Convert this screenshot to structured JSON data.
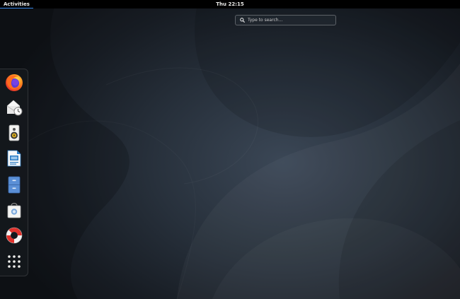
{
  "topbar": {
    "activities_label": "Activities",
    "clock": "Thu 22:15"
  },
  "search": {
    "placeholder": "Type to search…",
    "value": "",
    "icon": "search-icon"
  },
  "dash": {
    "items": [
      {
        "name": "firefox",
        "icon": "firefox-icon"
      },
      {
        "name": "evolution",
        "icon": "evolution-mail-icon"
      },
      {
        "name": "rhythmbox",
        "icon": "rhythmbox-speaker-icon"
      },
      {
        "name": "libreoffice-writer",
        "icon": "libreoffice-writer-icon"
      },
      {
        "name": "files",
        "icon": "files-cabinet-icon"
      },
      {
        "name": "software",
        "icon": "software-bag-icon"
      },
      {
        "name": "help",
        "icon": "help-lifebuoy-icon"
      },
      {
        "name": "show-applications",
        "icon": "app-grid-icon"
      }
    ]
  },
  "colors": {
    "topbar": "#000000",
    "accent": "#3584e4",
    "wallpaper_center": "#3b4756",
    "wallpaper_edge": "#111419"
  }
}
